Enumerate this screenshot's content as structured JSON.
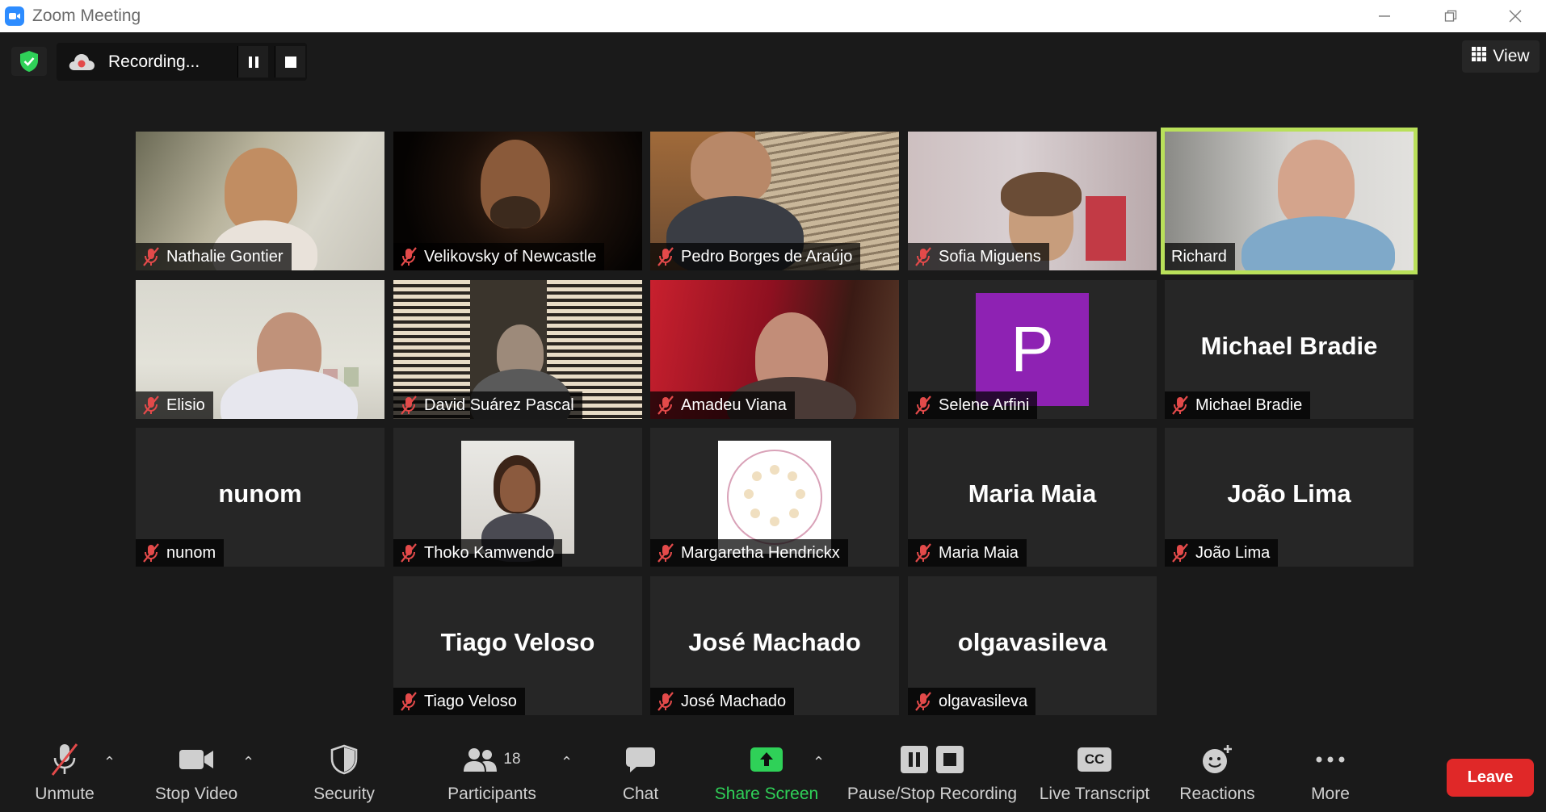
{
  "window": {
    "title": "Zoom Meeting"
  },
  "recording": {
    "label": "Recording..."
  },
  "view_button": {
    "label": "View"
  },
  "participants": [
    {
      "name": "Nathalie Gontier",
      "muted": true,
      "video": true
    },
    {
      "name": "Velikovsky of Newcastle",
      "muted": true,
      "video": true
    },
    {
      "name": "Pedro Borges de Araújo",
      "muted": true,
      "video": true
    },
    {
      "name": "Sofia Miguens",
      "muted": true,
      "video": true
    },
    {
      "name": "Richard",
      "muted": false,
      "video": true,
      "speaking": true
    },
    {
      "name": "Elisio",
      "muted": true,
      "video": true
    },
    {
      "name": "David Suárez Pascal",
      "muted": true,
      "video": true
    },
    {
      "name": "Amadeu Viana",
      "muted": true,
      "video": true
    },
    {
      "name": "Selene Arfini",
      "muted": true,
      "avatar_letter": "P"
    },
    {
      "name": "Michael Bradie",
      "muted": true,
      "display_name": "Michael Bradie"
    },
    {
      "name": "nunom",
      "muted": true,
      "display_name": "nunom"
    },
    {
      "name": "Thoko Kamwendo",
      "muted": true,
      "profile_picture": true
    },
    {
      "name": "Margaretha Hendrickx",
      "muted": true,
      "profile_picture": true
    },
    {
      "name": "Maria Maia",
      "muted": true,
      "display_name": "Maria Maia"
    },
    {
      "name": "João Lima",
      "muted": true,
      "display_name": "João Lima"
    },
    {
      "name": "Tiago Veloso",
      "muted": true,
      "display_name": "Tiago Veloso"
    },
    {
      "name": "José Machado",
      "muted": true,
      "display_name": "José Machado"
    },
    {
      "name": "olgavasileva",
      "muted": true,
      "display_name": "olgavasileva"
    }
  ],
  "toolbar": {
    "unmute": "Unmute",
    "stop_video": "Stop Video",
    "security": "Security",
    "participants": "Participants",
    "participants_count": "18",
    "chat": "Chat",
    "share_screen": "Share Screen",
    "pause_stop_recording": "Pause/Stop Recording",
    "live_transcript": "Live Transcript",
    "live_transcript_badge": "CC",
    "reactions": "Reactions",
    "more": "More",
    "leave": "Leave"
  },
  "colors": {
    "background": "#1a1a1a",
    "tile": "#262626",
    "speaking_outline": "#b9e05a",
    "muted_mic": "#e34a4a",
    "share_green": "#2fd158",
    "leave_red": "#e02828",
    "avatar_purple": "#8e22b3"
  }
}
